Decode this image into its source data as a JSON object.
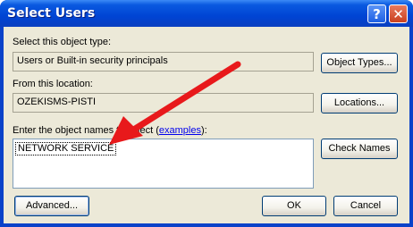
{
  "window": {
    "title": "Select Users",
    "help_glyph": "?",
    "close_glyph": "✕"
  },
  "object_type": {
    "label": "Select this object type:",
    "value": "Users or Built-in security principals",
    "button": "Object Types..."
  },
  "location": {
    "label": "From this location:",
    "value": "OZEKISMS-PISTI",
    "button": "Locations..."
  },
  "names": {
    "label_prefix": "Enter the object names to select (",
    "label_link": "examples",
    "label_suffix": "):",
    "value": "NETWORK SERVICE",
    "button": "Check Names"
  },
  "footer": {
    "advanced_button": "Advanced...",
    "ok_button": "OK",
    "cancel_button": "Cancel"
  },
  "annotation": {
    "arrow_color": "#e8191b"
  }
}
